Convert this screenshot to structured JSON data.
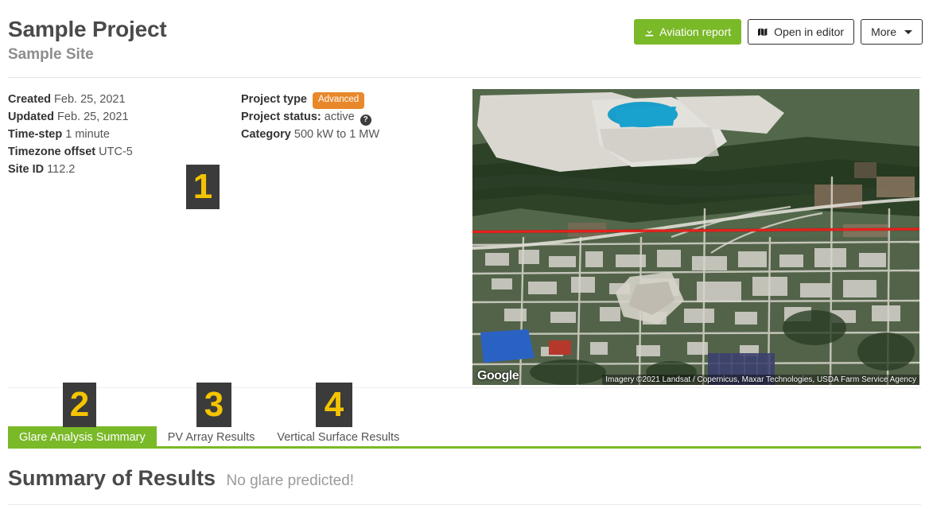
{
  "header": {
    "project_title": "Sample Project",
    "site_subtitle": "Sample Site",
    "actions": {
      "aviation_report": "Aviation report",
      "open_in_editor": "Open in editor",
      "more": "More",
      "download_icon": "download-icon",
      "map_icon": "map-icon",
      "caret_icon": "caret-down-icon"
    }
  },
  "info": {
    "left": [
      {
        "label": "Created",
        "value": "Feb. 25, 2021"
      },
      {
        "label": "Updated",
        "value": "Feb. 25, 2021"
      },
      {
        "label": "Time-step",
        "value": "1 minute"
      },
      {
        "label": "Timezone offset",
        "value": "UTC-5"
      },
      {
        "label": "Site ID",
        "value": "112.2"
      }
    ],
    "right": {
      "project_type_label": "Project type",
      "project_type_badge": "Advanced",
      "project_status_label": "Project status:",
      "project_status_value": "active",
      "help_icon": "?",
      "category_label": "Category",
      "category_value": "500 kW to 1 MW"
    }
  },
  "map": {
    "provider_logo": "Google",
    "attribution": "Imagery ©2021 Landsat / Copernicus, Maxar Technologies, USDA Farm Service Agency",
    "flight_path_color": "#e8201c"
  },
  "tabs": [
    {
      "label": "Glare Analysis Summary",
      "active": true
    },
    {
      "label": "PV Array Results",
      "active": false
    },
    {
      "label": "Vertical Surface Results",
      "active": false
    }
  ],
  "summary": {
    "heading": "Summary of Results",
    "status": "No glare predicted!"
  },
  "markers": [
    {
      "id": "1",
      "label": "1"
    },
    {
      "id": "2",
      "label": "2"
    },
    {
      "id": "3",
      "label": "3"
    },
    {
      "id": "4",
      "label": "4"
    }
  ],
  "colors": {
    "brand_green": "#7ab928",
    "badge_orange": "#e8882b",
    "marker_bg": "#3b3b3b",
    "marker_fg": "#f5c400"
  }
}
